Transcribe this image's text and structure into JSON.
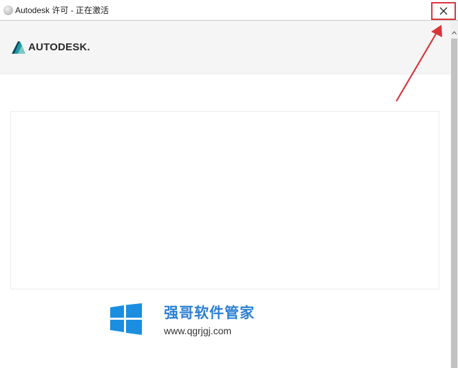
{
  "window": {
    "title": "Autodesk 许可 - 正在激活",
    "close_symbol": "✕"
  },
  "header": {
    "logo_text": "AUTODESK."
  },
  "watermark": {
    "title": "强哥软件管家",
    "url": "www.qgrjgj.com"
  },
  "icons": {
    "app": "app-icon",
    "close": "close-icon",
    "logo": "autodesk-logo-icon",
    "windows": "windows-logo-icon",
    "scroll_up": "chevron-up-icon"
  },
  "colors": {
    "accent_red": "#d9343a",
    "autodesk_teal": "#1f7a8c",
    "watermark_blue": "#2a7fd4"
  }
}
